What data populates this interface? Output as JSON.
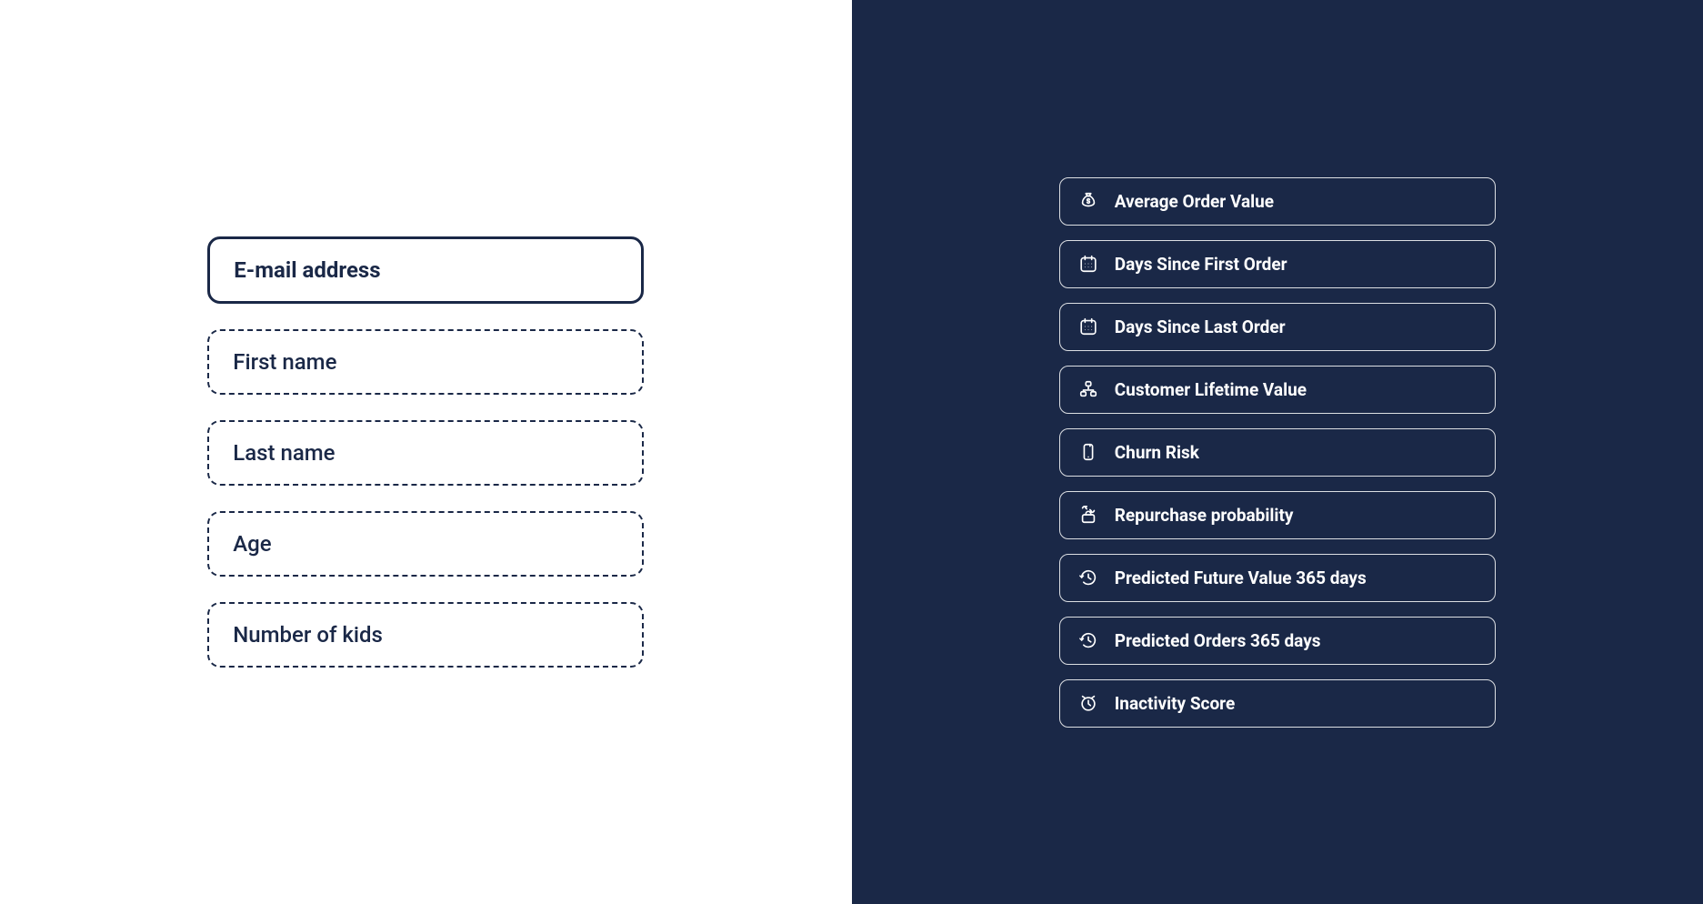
{
  "left": {
    "fields": [
      {
        "label": "E-mail address",
        "style": "solid"
      },
      {
        "label": "First name",
        "style": "dashed"
      },
      {
        "label": "Last name",
        "style": "dashed"
      },
      {
        "label": "Age",
        "style": "dashed"
      },
      {
        "label": "Number of kids",
        "style": "dashed"
      }
    ]
  },
  "right": {
    "metrics": [
      {
        "label": "Average Order Value",
        "icon": "money-bag-icon"
      },
      {
        "label": "Days Since First Order",
        "icon": "calendar-icon"
      },
      {
        "label": "Days Since Last Order",
        "icon": "calendar-icon"
      },
      {
        "label": "Customer Lifetime Value",
        "icon": "hierarchy-icon"
      },
      {
        "label": "Churn Risk",
        "icon": "phone-icon"
      },
      {
        "label": "Repurchase probability",
        "icon": "cart-repeat-icon"
      },
      {
        "label": "Predicted Future Value 365 days",
        "icon": "clock-forward-icon"
      },
      {
        "label": "Predicted Orders 365 days",
        "icon": "clock-forward-icon"
      },
      {
        "label": "Inactivity Score",
        "icon": "alarm-clock-icon"
      }
    ]
  }
}
